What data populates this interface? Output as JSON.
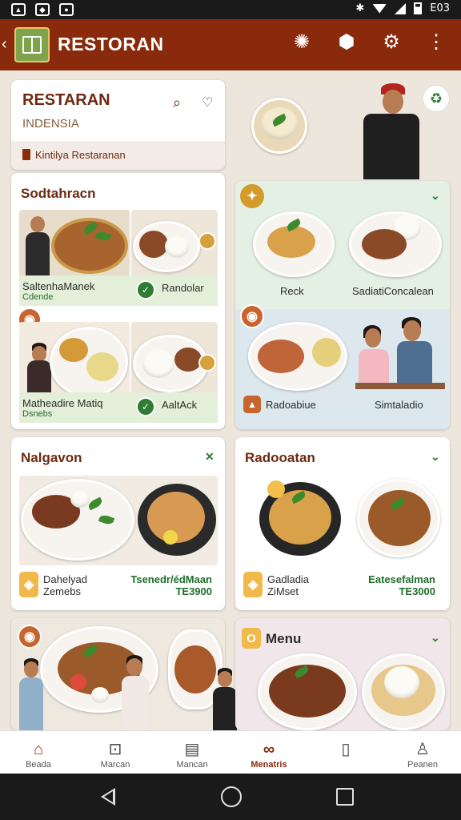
{
  "status": {
    "time": "E03"
  },
  "appbar": {
    "title": "RESTORAN",
    "back_icon": "chevron-left-icon",
    "actions": [
      "gear-icon",
      "bell-icon",
      "settings-icon",
      "more-vert-icon"
    ]
  },
  "header_card": {
    "title": "RESTARAN",
    "subtitle": "INDENSIA",
    "banner": "Kintilya Restaranan"
  },
  "card1": {
    "title": "Sodtahracn",
    "item1_name": "SaltenhaManek",
    "item1_sub": "Cdende",
    "item2_name": "Randolar",
    "item3_name": "Matheadire Matiq",
    "item3_sub": "Dsnebs",
    "item4_name": "AaltAck"
  },
  "card2": {
    "item1_name": "Reck",
    "item2_name": "SadiatiConcalean",
    "item3_name": "Radoabiue",
    "item4_name": "Simtaladio"
  },
  "card3": {
    "title": "Nalgavon",
    "item_name": "Dahelyad",
    "item_sub": "Zemebs",
    "price_name": "Tsenedr/édMaan",
    "price": "TE3900"
  },
  "card4": {
    "title": "Radooatan",
    "item_name": "Gadladia",
    "item_sub": "ZiMset",
    "price_name": "Eatesefalman",
    "price": "TE3000"
  },
  "card6": {
    "title": "Menu",
    "badge": "O"
  },
  "bottom_nav": [
    {
      "label": "Beada",
      "icon": "home-icon"
    },
    {
      "label": "Marcan",
      "icon": "bag-icon"
    },
    {
      "label": "Mancan",
      "icon": "document-icon"
    },
    {
      "label": "Menatris",
      "icon": "pretzel-icon"
    },
    {
      "label": "",
      "icon": "clipboard-icon"
    },
    {
      "label": "Peanen",
      "icon": "person-icon"
    }
  ],
  "colors": {
    "appbar": "#8a2a0c",
    "accent_green": "#2e7d32",
    "title_brown": "#6b2a12",
    "price_green": "#1f6f2a"
  }
}
